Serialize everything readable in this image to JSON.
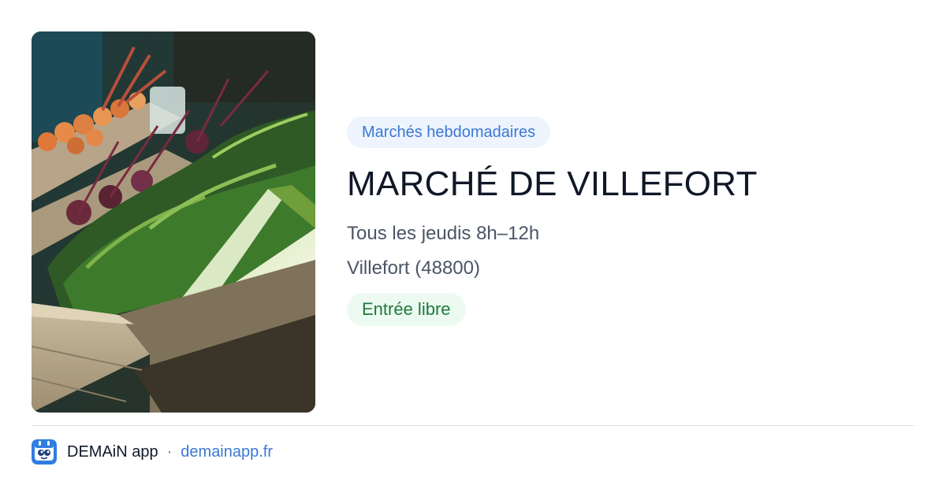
{
  "event": {
    "image": {
      "description_icon": "vegetable-crates-photo"
    },
    "category": "Marchés hebdomadaires",
    "title": "MARCHÉ DE VILLEFORT",
    "schedule": "Tous les jeudis 8h–12h",
    "location": "Villefort (48800)",
    "access": "Entrée libre"
  },
  "footer": {
    "app_name": "DEMAiN app",
    "separator": "·",
    "link_text": "demainapp.fr",
    "logo_icon": "demain-app-logo-icon"
  },
  "colors": {
    "accent_blue": "#3a78d4",
    "category_bg": "#eef4fd",
    "access_green": "#1f7a3a",
    "access_bg": "#edfaf1",
    "title": "#101828",
    "body_text": "#4a5565",
    "divider": "#dbe2e6"
  }
}
